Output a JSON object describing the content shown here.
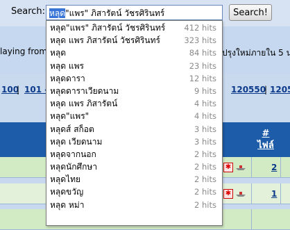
{
  "search": {
    "label": "Search:",
    "query_selected": "หลุด",
    "query_rest": "\"แพร\" ภิสารัตน์ วัชรศิรินทร์",
    "button_label": "Search!"
  },
  "page": {
    "playing_text": "laying from",
    "update_text": "ปรุงใหม่ภายใน 5 น",
    "pager": [
      {
        "label": "100",
        "sep": "|"
      },
      {
        "label": "101 -",
        "sep": ""
      },
      {
        "label": "120550",
        "sep": "|"
      },
      {
        "label": "1205",
        "sep": ""
      }
    ],
    "column_header": "#\nไฟล์",
    "rows": [
      {
        "count": "2"
      },
      {
        "count": "1"
      }
    ]
  },
  "suggestions": [
    {
      "term": "หลุด\"แพร\" ภิสารัตน์ วัชรศิรินทร์",
      "hits": "412 hits"
    },
    {
      "term": "หลุด แพร ภิสารัตน์ วัชรศิรินทร์",
      "hits": "323 hits"
    },
    {
      "term": "หลุด",
      "hits": "84 hits"
    },
    {
      "term": "หลุด แพร",
      "hits": "23 hits"
    },
    {
      "term": "หลุดดารา",
      "hits": "12 hits"
    },
    {
      "term": "หลุดดาราเวียดนาม",
      "hits": "9 hits"
    },
    {
      "term": "หลุด แพร ภิสารัตน์",
      "hits": "4 hits"
    },
    {
      "term": "หลุด\"แพร\"",
      "hits": "4 hits"
    },
    {
      "term": "หลุดส์ สก็อต",
      "hits": "3 hits"
    },
    {
      "term": "หลุด เวียดนาม",
      "hits": "3 hits"
    },
    {
      "term": "หลุดจากนอก",
      "hits": "2 hits"
    },
    {
      "term": "หลุดนักศึกษา",
      "hits": "2 hits"
    },
    {
      "term": "หลุดไทย",
      "hits": "2 hits"
    },
    {
      "term": "หลุดขวัญ",
      "hits": "2 hits"
    },
    {
      "term": "หลุด หม่า",
      "hits": "2 hits"
    }
  ],
  "colors": {
    "accent": "#1d5ca8",
    "link": "#0b3a8a",
    "selection": "#3875d7"
  }
}
